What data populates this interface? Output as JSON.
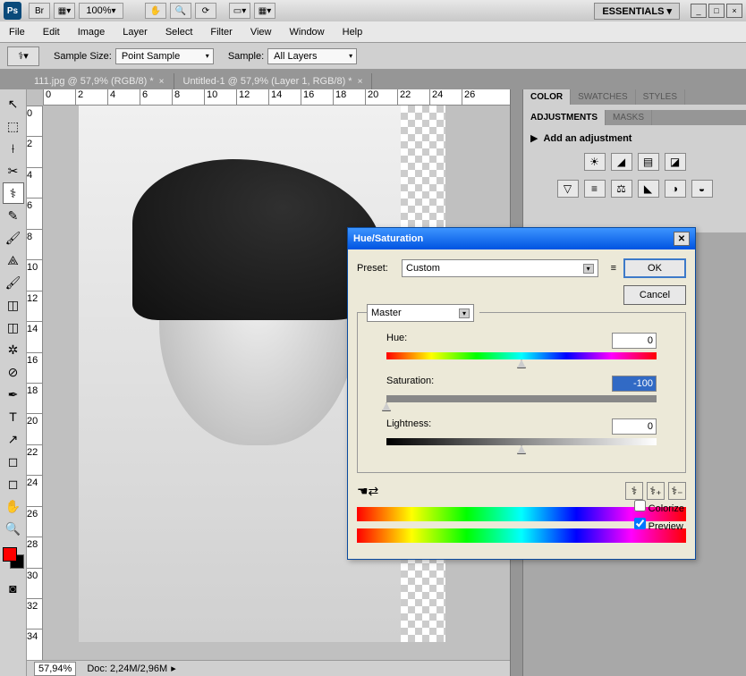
{
  "app_icon": "Ps",
  "zoom_dropdown": "100%",
  "workspace": "ESSENTIALS",
  "menu": {
    "file": "File",
    "edit": "Edit",
    "image": "Image",
    "layer": "Layer",
    "select": "Select",
    "filter": "Filter",
    "view": "View",
    "window": "Window",
    "help": "Help"
  },
  "options": {
    "sample_size_label": "Sample Size:",
    "sample_size_value": "Point Sample",
    "sample_label": "Sample:",
    "sample_value": "All Layers"
  },
  "tabs": [
    {
      "label": "111.jpg @ 57,9% (RGB/8) *"
    },
    {
      "label": "Untitled-1 @ 57,9% (Layer 1, RGB/8) *"
    }
  ],
  "ruler_h": [
    "0",
    "2",
    "4",
    "6",
    "8",
    "10",
    "12",
    "14",
    "16",
    "18",
    "20",
    "22",
    "24",
    "26"
  ],
  "ruler_v": [
    "0",
    "2",
    "4",
    "6",
    "8",
    "10",
    "12",
    "14",
    "16",
    "18",
    "20",
    "22",
    "24",
    "26",
    "28",
    "30",
    "32",
    "34"
  ],
  "status": {
    "zoom": "57,94%",
    "doc": "Doc: 2,24M/2,96M"
  },
  "panels": {
    "color_tabs": [
      "COLOR",
      "SWATCHES",
      "STYLES"
    ],
    "adj_tabs": [
      "ADJUSTMENTS",
      "MASKS"
    ],
    "add_adjustment": "Add an adjustment",
    "adj_icons": [
      "☀",
      "◢",
      "▤",
      "◪",
      "▽",
      "≡",
      "⚖",
      "◣",
      "◑",
      "◒"
    ]
  },
  "dialog": {
    "title": "Hue/Saturation",
    "preset_label": "Preset:",
    "preset_value": "Custom",
    "ok": "OK",
    "cancel": "Cancel",
    "master": "Master",
    "hue_label": "Hue:",
    "hue_value": "0",
    "sat_label": "Saturation:",
    "sat_value": "-100",
    "light_label": "Lightness:",
    "light_value": "0",
    "colorize": "Colorize",
    "preview": "Preview"
  },
  "tools": [
    "↖",
    "⬚",
    "⟊",
    "✂",
    "✎",
    "⌕",
    "⚕",
    "🖌",
    "⟁",
    "◫",
    "✲",
    "⊘",
    "✒",
    "T",
    "↗",
    "◻",
    "✋",
    "🔍"
  ]
}
